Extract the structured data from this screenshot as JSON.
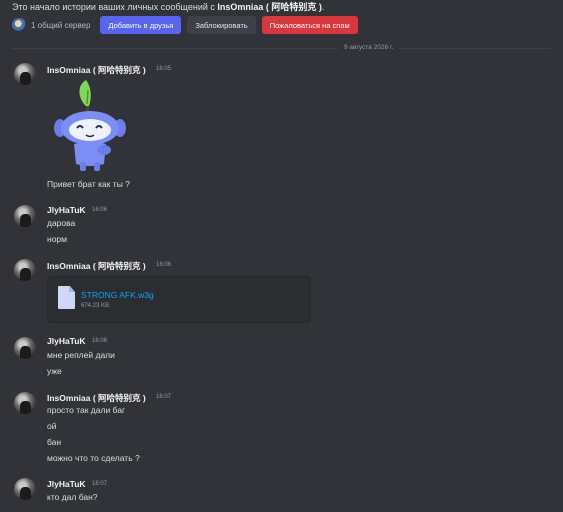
{
  "intro": {
    "prefix": "Это начало истории ваших личных сообщений с",
    "username": "InsOmniaa ( 阿哈特别克 )",
    "suffix": "."
  },
  "actions": {
    "mutual_servers": "1 общий сервер",
    "add_friend": "Добавить в друзья",
    "block": "Заблокировать",
    "report_spam": "Пожаловаться на спам"
  },
  "date_divider": "9 августа 2026 г.",
  "messages": [
    {
      "author": "InsOmniaa ( 阿哈特别克 )",
      "time": "16:05",
      "sticker": "wumpus-sticker",
      "lines": [
        "Привет брат как ты ?"
      ]
    },
    {
      "author": "JlyHaTuK",
      "time": "16:06",
      "lines": [
        "дарова",
        "норм"
      ]
    },
    {
      "author": "InsOmniaa ( 阿哈特别克 )",
      "time": "16:06",
      "attachment": {
        "name": "STRONG AFK.w3g",
        "size": "674.23 KB"
      }
    },
    {
      "author": "JlyHaTuK",
      "time": "16:06",
      "lines": [
        "мне реплей дали",
        "уже"
      ]
    },
    {
      "author": "InsOmniaa ( 阿哈特别克 )",
      "time": "16:07",
      "lines": [
        "просто так дали баг",
        "ой",
        "бан",
        "можно что то сделать ?"
      ]
    },
    {
      "author": "JlyHaTuK",
      "time": "16:07",
      "lines": [
        "кто дал бан?"
      ]
    }
  ],
  "colors": {
    "background": "#313338",
    "primary_button": "#5865f2",
    "danger_button": "#da373c",
    "link": "#00a8fc"
  }
}
